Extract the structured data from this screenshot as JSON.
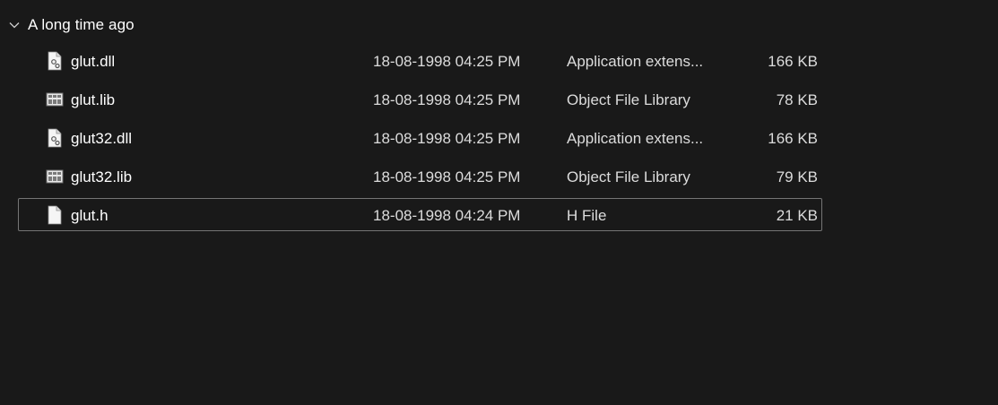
{
  "group": {
    "title": "A long time ago",
    "icon": "chevron-down-icon"
  },
  "files": [
    {
      "name": "glut.dll",
      "date": "18-08-1998 04:25 PM",
      "type": "Application extens...",
      "size": "166 KB",
      "icon": "dll-file-icon"
    },
    {
      "name": "glut.lib",
      "date": "18-08-1998 04:25 PM",
      "type": "Object File Library",
      "size": "78 KB",
      "icon": "library-file-icon"
    },
    {
      "name": "glut32.dll",
      "date": "18-08-1998 04:25 PM",
      "type": "Application extens...",
      "size": "166 KB",
      "icon": "dll-file-icon"
    },
    {
      "name": "glut32.lib",
      "date": "18-08-1998 04:25 PM",
      "type": "Object File Library",
      "size": "79 KB",
      "icon": "library-file-icon"
    },
    {
      "name": "glut.h",
      "date": "18-08-1998 04:24 PM",
      "type": "H File",
      "size": "21 KB",
      "icon": "blank-file-icon",
      "selected": true
    }
  ],
  "colors": {
    "background": "#191919",
    "text": "#ffffff",
    "selection_border": "#757575"
  }
}
